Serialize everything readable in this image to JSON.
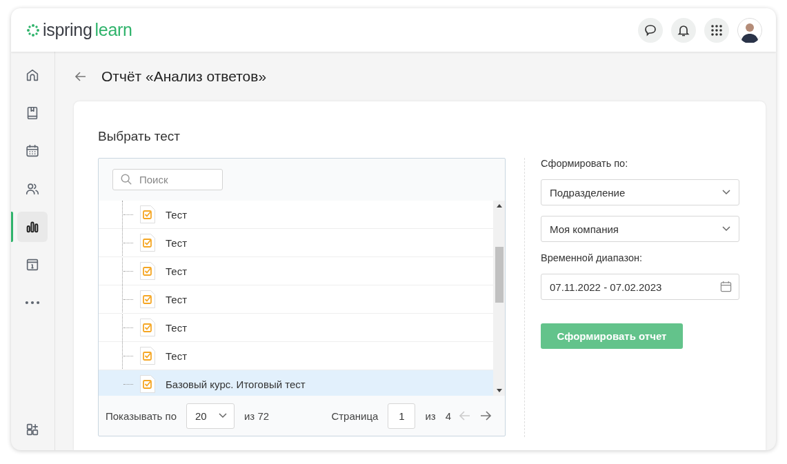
{
  "header": {
    "logo": {
      "brand": "ispring",
      "product": "learn"
    },
    "buttons": [
      {
        "kind": "chat"
      },
      {
        "kind": "bell"
      },
      {
        "kind": "apps"
      }
    ]
  },
  "sidebar": {
    "items": [
      {
        "kind": "home",
        "selected": false
      },
      {
        "kind": "book",
        "selected": false
      },
      {
        "kind": "calendar",
        "selected": false
      },
      {
        "kind": "users",
        "selected": false
      },
      {
        "kind": "chart",
        "selected": true
      },
      {
        "kind": "info",
        "selected": false
      },
      {
        "kind": "more",
        "selected": false
      }
    ],
    "bottom": {
      "kind": "add-apps",
      "selected": false
    }
  },
  "page": {
    "title": "Отчёт «Анализ ответов»"
  },
  "card": {
    "heading": "Выбрать тест",
    "search": {
      "placeholder": "Поиск"
    },
    "tree": [
      {
        "label": "Тест",
        "selected": false
      },
      {
        "label": "Тест",
        "selected": false
      },
      {
        "label": "Тест",
        "selected": false
      },
      {
        "label": "Тест",
        "selected": false
      },
      {
        "label": "Тест",
        "selected": false
      },
      {
        "label": "Тест",
        "selected": false
      },
      {
        "label": "Базовый курс. Итоговый тест",
        "selected": true
      }
    ],
    "pager": {
      "show_label": "Показывать по",
      "page_size": "20",
      "total": "из 72",
      "page_label": "Страница",
      "page": "1",
      "pages_label": "из",
      "pages": "4",
      "prev_disabled": true,
      "next_disabled": false
    },
    "options": {
      "group_label": "Сформировать по:",
      "group_value": "Подразделение",
      "scope_value": "Моя компания",
      "range_label": "Временной диапазон:",
      "range_value": "07.11.2022 - 07.02.2023",
      "submit": "Сформировать отчет"
    }
  }
}
